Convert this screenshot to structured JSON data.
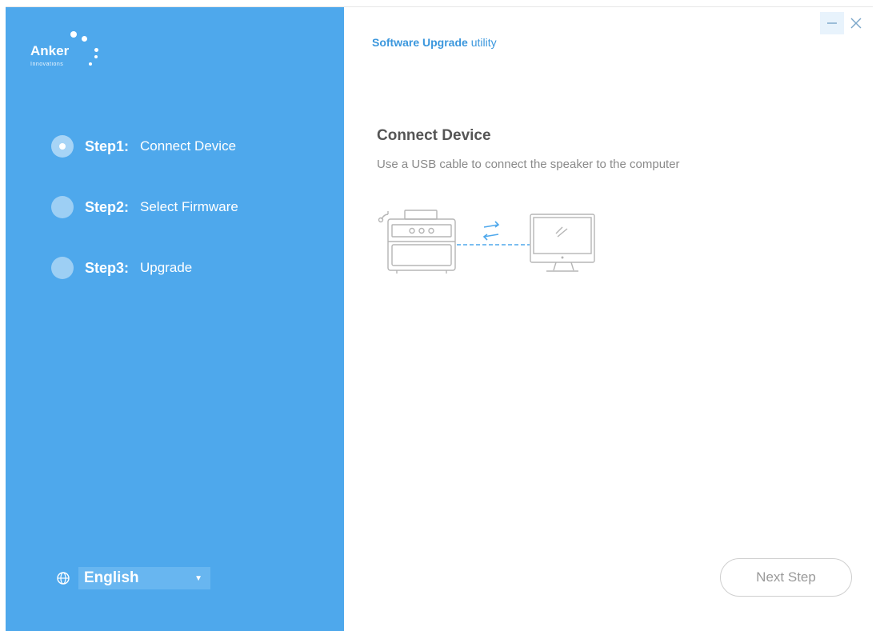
{
  "logo": {
    "name": "Anker",
    "sub": "Innovations"
  },
  "header": {
    "title_bold": "Software Upgrade",
    "title_rest": " utility"
  },
  "steps": [
    {
      "num": "Step1:",
      "label": "Connect Device",
      "active": true
    },
    {
      "num": "Step2:",
      "label": "Select Firmware",
      "active": false
    },
    {
      "num": "Step3:",
      "label": "Upgrade",
      "active": false
    }
  ],
  "language": {
    "selected": "English",
    "icon": "globe-icon"
  },
  "content": {
    "title": "Connect Device",
    "description": "Use a USB cable to connect the speaker to the computer"
  },
  "footer": {
    "next_label": "Next Step"
  },
  "colors": {
    "sidebar": "#4ea8ec",
    "accent": "#3b97dd",
    "illustration_stroke": "#b5b5b5",
    "connector": "#4ea8ec"
  },
  "icons": {
    "minimize": "minimize-icon",
    "close": "close-icon",
    "speaker": "speaker-icon",
    "monitor": "monitor-icon",
    "transfer": "transfer-arrows-icon"
  }
}
